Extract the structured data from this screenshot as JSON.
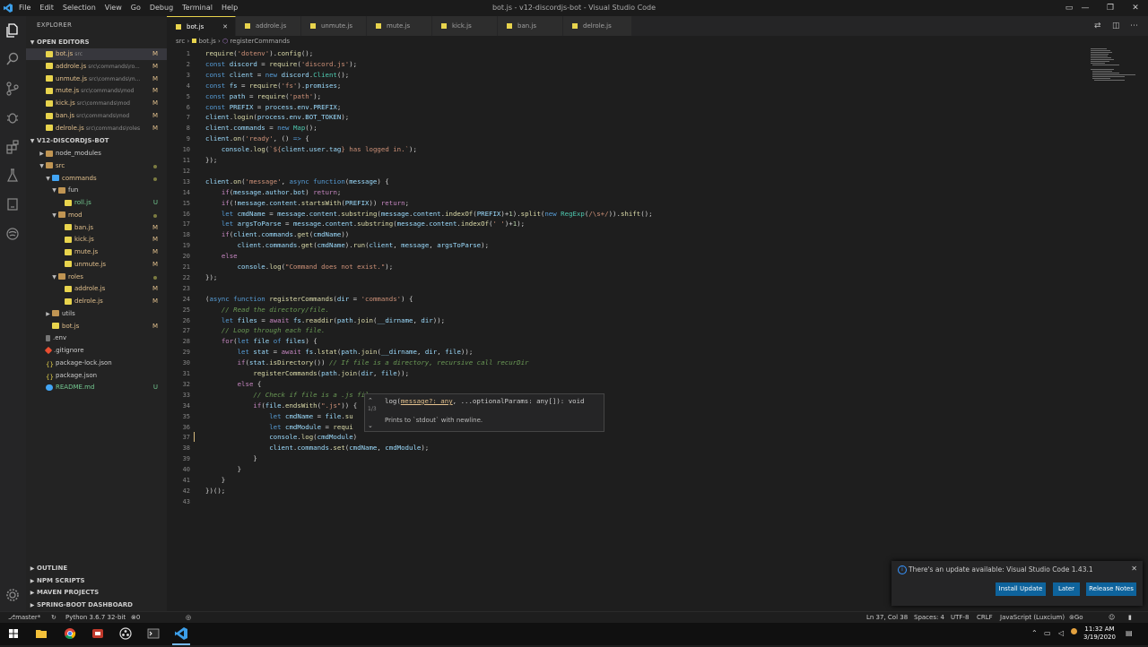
{
  "titlebar": {
    "menu": [
      "File",
      "Edit",
      "Selection",
      "View",
      "Go",
      "Debug",
      "Terminal",
      "Help"
    ],
    "title": "bot.js - v12-discordjs-bot - Visual Studio Code"
  },
  "sidebar": {
    "header": "EXPLORER",
    "open_editors_label": "OPEN EDITORS",
    "open_editors": [
      {
        "name": "bot.js",
        "path": "src",
        "status": "M"
      },
      {
        "name": "addrole.js",
        "path": "src\\commands\\ro...",
        "status": "M"
      },
      {
        "name": "unmute.js",
        "path": "src\\commands\\m...",
        "status": "M"
      },
      {
        "name": "mute.js",
        "path": "src\\commands\\mod",
        "status": "M"
      },
      {
        "name": "kick.js",
        "path": "src\\commands\\mod",
        "status": "M"
      },
      {
        "name": "ban.js",
        "path": "src\\commands\\mod",
        "status": "M"
      },
      {
        "name": "delrole.js",
        "path": "src\\commands\\roles",
        "status": "M"
      }
    ],
    "project_label": "V12-DISCORDJS-BOT",
    "tree": [
      {
        "name": "node_modules",
        "type": "folder",
        "depth": 1,
        "status": ""
      },
      {
        "name": "src",
        "type": "folder",
        "depth": 1,
        "status": "dot"
      },
      {
        "name": "commands",
        "type": "folderb",
        "depth": 2,
        "status": "dot"
      },
      {
        "name": "fun",
        "type": "folder",
        "depth": 3,
        "status": ""
      },
      {
        "name": "roll.js",
        "type": "js",
        "depth": 4,
        "status": "U"
      },
      {
        "name": "mod",
        "type": "folder",
        "depth": 3,
        "status": "dot"
      },
      {
        "name": "ban.js",
        "type": "js",
        "depth": 4,
        "status": "M"
      },
      {
        "name": "kick.js",
        "type": "js",
        "depth": 4,
        "status": "M"
      },
      {
        "name": "mute.js",
        "type": "js",
        "depth": 4,
        "status": "M"
      },
      {
        "name": "unmute.js",
        "type": "js",
        "depth": 4,
        "status": "M"
      },
      {
        "name": "roles",
        "type": "folder",
        "depth": 3,
        "status": "dot"
      },
      {
        "name": "addrole.js",
        "type": "js",
        "depth": 4,
        "status": "M"
      },
      {
        "name": "delrole.js",
        "type": "js",
        "depth": 4,
        "status": "M"
      },
      {
        "name": "utils",
        "type": "folder",
        "depth": 2,
        "status": ""
      },
      {
        "name": "bot.js",
        "type": "js",
        "depth": 2,
        "status": "M"
      },
      {
        "name": ".env",
        "type": "env",
        "depth": 1,
        "status": ""
      },
      {
        "name": ".gitignore",
        "type": "git",
        "depth": 1,
        "status": ""
      },
      {
        "name": "package-lock.json",
        "type": "json",
        "depth": 1,
        "status": ""
      },
      {
        "name": "package.json",
        "type": "json",
        "depth": 1,
        "status": ""
      },
      {
        "name": "README.md",
        "type": "md",
        "depth": 1,
        "status": "U"
      }
    ],
    "bottom_sections": [
      "OUTLINE",
      "NPM SCRIPTS",
      "MAVEN PROJECTS",
      "SPRING-BOOT DASHBOARD"
    ]
  },
  "tabs": [
    "bot.js",
    "addrole.js",
    "unmute.js",
    "mute.js",
    "kick.js",
    "ban.js",
    "delrole.js"
  ],
  "breadcrumb": [
    "src",
    "bot.js",
    "registerCommands"
  ],
  "tooltip": {
    "signature_name": "log(",
    "signature_param": "message?: any",
    "signature_rest": ", ...optionalParams: any[]): void",
    "counter": "1/3",
    "description": "Prints to `stdout` with newline."
  },
  "notification": {
    "message": "There's an update available: Visual Studio Code 1.43.1",
    "buttons": [
      "Install Update",
      "Later",
      "Release Notes"
    ]
  },
  "statusbar": {
    "branch": "master*",
    "python": "Python 3.6.7 32-bit",
    "problems": "0 ⚠ 0",
    "cursor": "Ln 37, Col 38",
    "spaces": "Spaces: 4",
    "encoding": "UTF-8",
    "eol": "CRLF",
    "language": "JavaScript (Luxcium)",
    "live": "Go Live"
  },
  "taskbar": {
    "time": "11:32 AM",
    "date": "3/19/2020"
  }
}
